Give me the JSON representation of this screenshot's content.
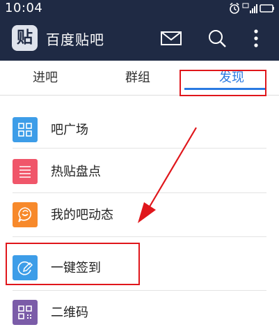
{
  "status_bar": {
    "time": "10:04"
  },
  "app": {
    "title": "百度贴吧",
    "logo_char": "贴"
  },
  "tabs": [
    {
      "label": "进吧"
    },
    {
      "label": "群组"
    },
    {
      "label": "发现",
      "active": true
    }
  ],
  "discover_items": [
    {
      "label": "吧广场",
      "icon": "grid-icon",
      "color": "#3d9de8"
    },
    {
      "label": "热贴盘点",
      "icon": "list-icon",
      "color": "#f0566a"
    },
    {
      "label": "我的吧动态",
      "icon": "chat-bubble-icon",
      "color": "#f7892b"
    },
    {
      "label": "一键签到",
      "icon": "sign-pen-icon",
      "color": "#3d9de8"
    },
    {
      "label": "二维码",
      "icon": "qr-code-icon",
      "color": "#7b5ca8"
    }
  ],
  "colors": {
    "header_bg": "#1f2a44",
    "accent": "#2a7ae2",
    "annotation": "#e0161b"
  }
}
